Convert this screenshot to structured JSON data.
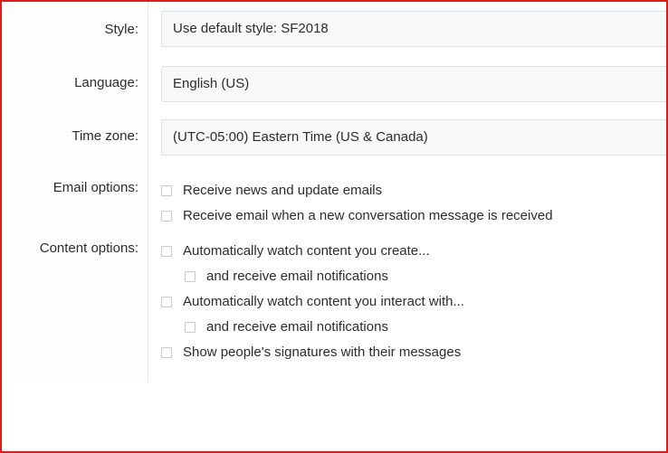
{
  "labels": {
    "style": "Style:",
    "language": "Language:",
    "timezone": "Time zone:",
    "email_options": "Email options:",
    "content_options": "Content options:"
  },
  "fields": {
    "style": {
      "value": "Use default style: SF2018"
    },
    "language": {
      "value": "English (US)"
    },
    "timezone": {
      "value": "(UTC-05:00) Eastern Time (US & Canada)"
    }
  },
  "email_options": [
    {
      "label": "Receive news and update emails",
      "checked": false
    },
    {
      "label": "Receive email when a new conversation message is received",
      "checked": false
    }
  ],
  "content_options": [
    {
      "label": "Automatically watch content you create...",
      "checked": false,
      "indent": false
    },
    {
      "label": "and receive email notifications",
      "checked": false,
      "indent": true
    },
    {
      "label": "Automatically watch content you interact with...",
      "checked": false,
      "indent": false
    },
    {
      "label": "and receive email notifications",
      "checked": false,
      "indent": true
    },
    {
      "label": "Show people's signatures with their messages",
      "checked": false,
      "indent": false
    }
  ]
}
